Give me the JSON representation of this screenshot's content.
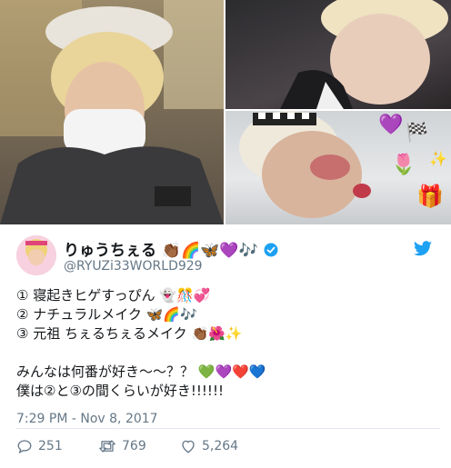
{
  "tweet": {
    "display_name": "りゅうちぇる 👏🏾🌈🦋💜🎶",
    "handle": "@RYUZi33WORLD929",
    "lines": [
      "① 寝起きヒゲすっぴん 👻🎊💞",
      "② ナチュラルメイク 🦋🌈🎶",
      "③ 元祖 ちぇるちぇるメイク 👏🏾🌺✨",
      "",
      "みんなは何番が好き～～？？ 💚💜❤️💙",
      "僕は②と③の間くらいが好き!!!!!!"
    ],
    "timestamp": "7:29 PM - Nov 8, 2017",
    "replies": "251",
    "retweets": "769",
    "likes": "5,264"
  },
  "colors": {
    "brand_blue": "#1da1f2",
    "verified_blue": "#1da1f2",
    "meta_gray": "#657786",
    "divider": "#e1e8ed"
  },
  "icons": [
    "reply-icon",
    "retweet-icon",
    "heart-icon",
    "twitter-bird-icon",
    "verified-badge-icon"
  ]
}
